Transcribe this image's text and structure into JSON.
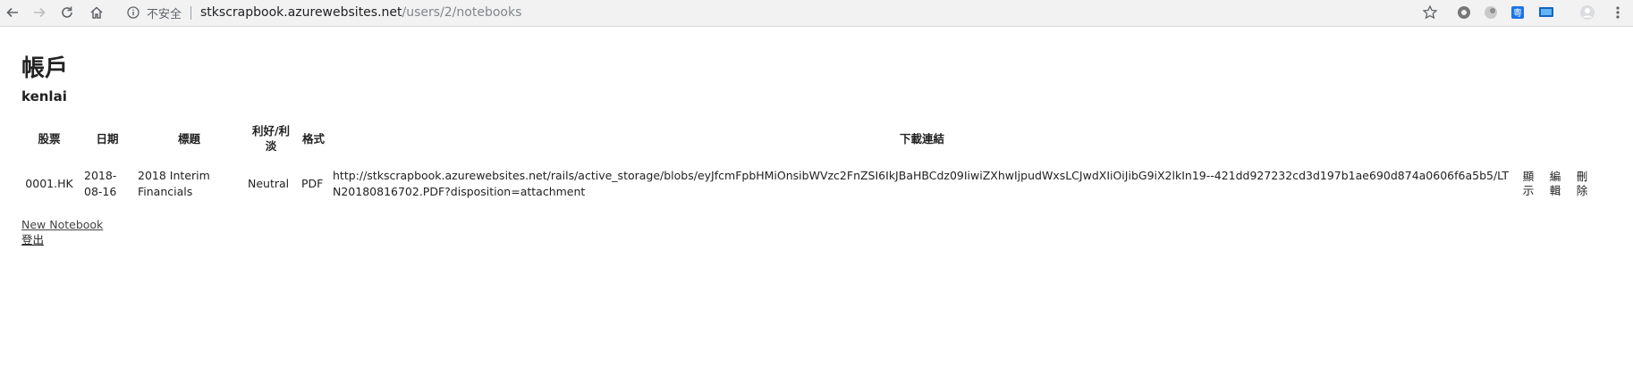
{
  "browser": {
    "security_label": "不安全",
    "url_host": "stkscrapbook.azurewebsites.net",
    "url_path": "/users/2/notebooks"
  },
  "page": {
    "title": "帳戶",
    "username": "kenlai"
  },
  "table": {
    "headers": [
      "股票",
      "日期",
      "標題",
      "利好/利淡",
      "格式",
      "下載連結"
    ],
    "rows": [
      {
        "code": "0001.HK",
        "date": "2018-08-16",
        "title": "2018 Interim Financials",
        "sentiment": "Neutral",
        "format": "PDF",
        "link": "http://stkscrapbook.azurewebsites.net/rails/active_storage/blobs/eyJfcmFpbHMiOnsibWVzc2FnZSI6IkJBaHBCdz09IiwiZXhwIjpudWxsLCJwdXIiOiJibG9iX2lkIn19--421dd927232cd3d197b1ae690d874a0606f6a5b5/LTN20180816702.PDF?disposition=attachment",
        "actions": [
          "顯示",
          "編輯",
          "刪除"
        ]
      }
    ]
  },
  "links": {
    "new_notebook": "New Notebook",
    "logout": "登出"
  }
}
